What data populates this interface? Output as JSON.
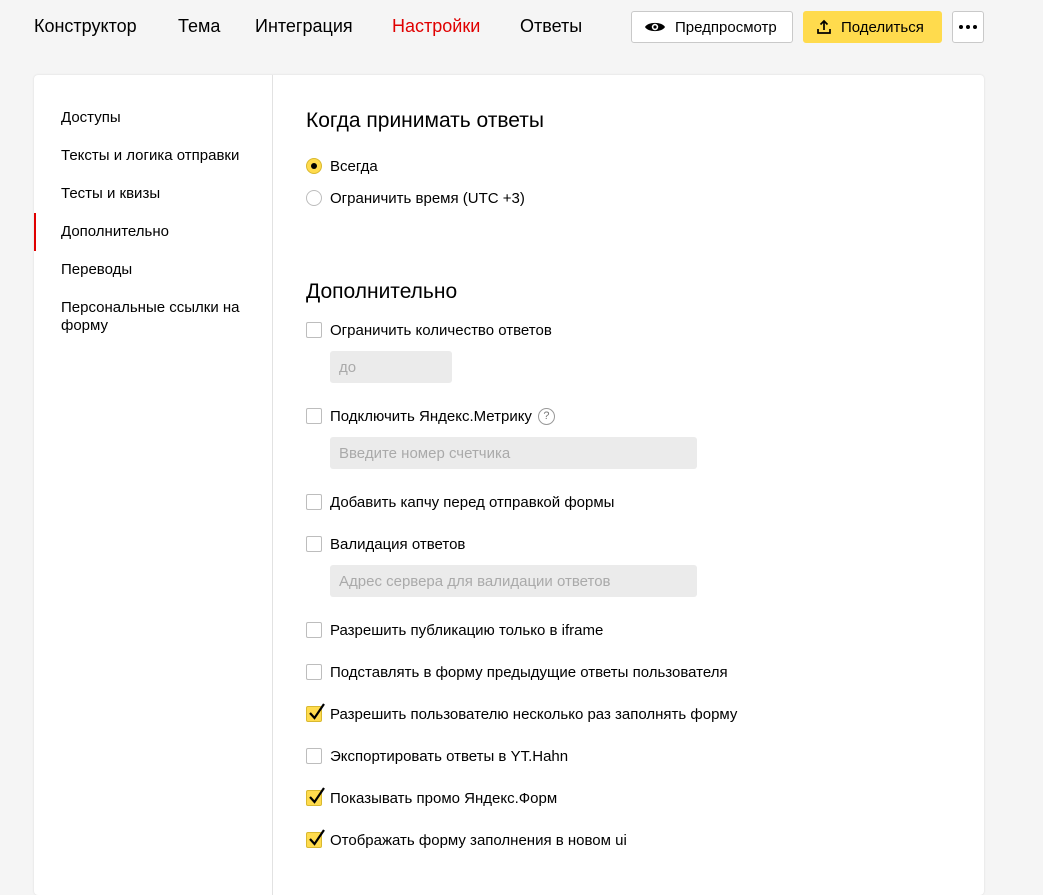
{
  "nav": {
    "tabs": [
      {
        "label": "Конструктор",
        "active": false
      },
      {
        "label": "Тема",
        "active": false
      },
      {
        "label": "Интеграция",
        "active": false
      },
      {
        "label": "Настройки",
        "active": true
      },
      {
        "label": "Ответы",
        "active": false
      }
    ],
    "preview_label": "Предпросмотр",
    "share_label": "Поделиться",
    "accent_color": "#e00000",
    "share_color": "#ffdb4d"
  },
  "sidebar": {
    "items": [
      {
        "label": "Доступы"
      },
      {
        "label": "Тексты и логика отправки"
      },
      {
        "label": "Тесты и квизы"
      },
      {
        "label": "Дополнительно",
        "active": true
      },
      {
        "label": "Переводы"
      },
      {
        "label": "Персональные ссылки на форму"
      }
    ]
  },
  "responses": {
    "title": "Когда принимать ответы",
    "options": [
      {
        "label": "Всегда",
        "checked": true
      },
      {
        "label": "Ограничить время (UTC +3)",
        "checked": false
      }
    ]
  },
  "additional": {
    "title": "Дополнительно",
    "limit": {
      "label": "Ограничить количество ответов",
      "checked": false,
      "placeholder": "до"
    },
    "metrika": {
      "label": "Подключить Яндекс.Метрику",
      "checked": false,
      "placeholder": "Введите номер счетчика",
      "help_icon": "question-circle-icon"
    },
    "captcha": {
      "label": "Добавить капчу перед отправкой формы",
      "checked": false
    },
    "validation": {
      "label": "Валидация ответов",
      "checked": false,
      "placeholder": "Адрес сервера для валидации ответов"
    },
    "iframe": {
      "label": "Разрешить публикацию только в iframe",
      "checked": false
    },
    "prefill": {
      "label": "Подставлять в форму предыдущие ответы пользователя",
      "checked": false
    },
    "multiple": {
      "label": "Разрешить пользователю несколько раз заполнять форму",
      "checked": true
    },
    "export": {
      "label": "Экспортировать ответы в YT.Hahn",
      "checked": false
    },
    "promo": {
      "label": "Показывать промо Яндекс.Форм",
      "checked": true
    },
    "new_ui": {
      "label": "Отображать форму заполнения в новом ui",
      "checked": true
    }
  }
}
